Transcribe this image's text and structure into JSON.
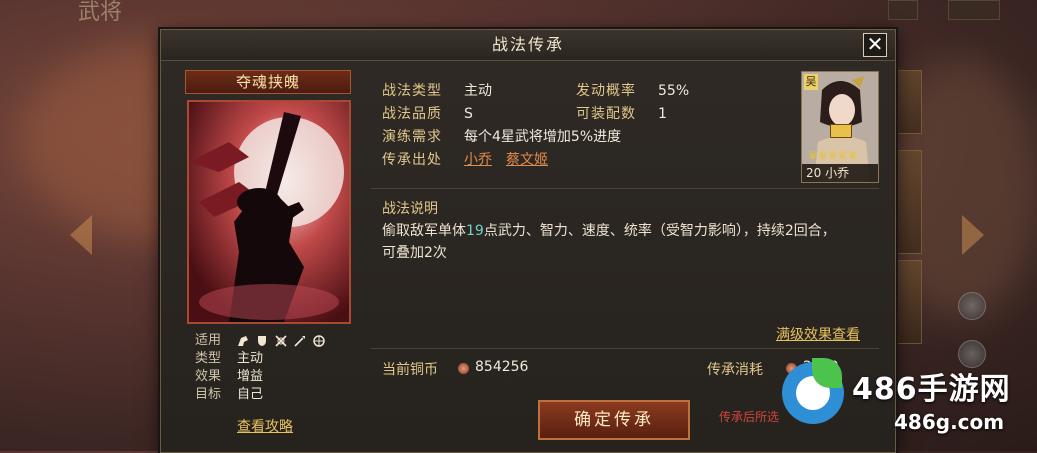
{
  "background": {
    "title": "武将"
  },
  "dialog": {
    "title": "战法传承",
    "close_glyph": "✕"
  },
  "skill": {
    "name": "夺魂挟魄",
    "info": {
      "type_label": "战法类型",
      "type_value": "主动",
      "rate_label": "发动概率",
      "rate_value": "55%",
      "quality_label": "战法品质",
      "quality_value": "S",
      "slots_label": "可装配数",
      "slots_value": "1",
      "train_label": "演练需求",
      "train_value": "每个4星武将增加5%进度",
      "source_label": "传承出处",
      "sources": [
        "小乔",
        "蔡文姬"
      ]
    },
    "attrs": {
      "apply_label": "适用",
      "unit_icons": [
        "cavalry-icon",
        "shield-icon",
        "archer-icon",
        "spear-icon",
        "siege-icon"
      ],
      "type_label": "类型",
      "type_value": "主动",
      "effect_label": "效果",
      "effect_value": "增益",
      "target_label": "目标",
      "target_value": "自己"
    },
    "strategy_link": "查看攻略",
    "description": {
      "title": "战法说明",
      "line1_a": "偷取敌军单体",
      "line1_hl": "19",
      "line1_b": "点武力、智力、速度、统率（受智力影响），持续2回合，",
      "line2": "可叠加2次"
    },
    "full_effect_link": "满级效果查看"
  },
  "general": {
    "faction": "吴",
    "stars": "♛♛♛♛♛",
    "level_name": "20 小乔"
  },
  "footer": {
    "coin_label": "当前铜币",
    "coin_value": "854256",
    "cost_label": "传承消耗",
    "cost_value": "2000",
    "confirm_label": "确定传承",
    "hint": "传承后所选"
  },
  "watermark": {
    "text": "486手游网",
    "domain": "486g.com"
  },
  "colors": {
    "accent_gold": "#e0c78a",
    "link_orange": "#e28b4a",
    "highlight_cyan": "#6fd4c8",
    "confirm_red": "#8a3a20"
  }
}
